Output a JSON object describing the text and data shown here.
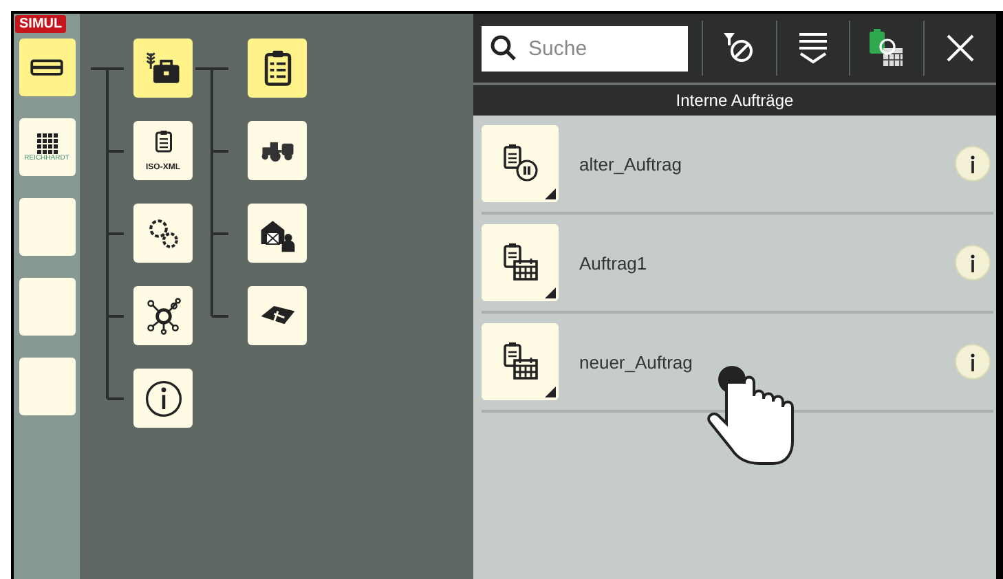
{
  "badge": "SIMUL",
  "sidebar": [
    {
      "kind": "card",
      "selected": true
    },
    {
      "kind": "logo",
      "text": "REICHHARDT",
      "selected": false
    },
    {
      "kind": "blank",
      "selected": false
    },
    {
      "kind": "blank",
      "selected": false
    },
    {
      "kind": "blank",
      "selected": false
    }
  ],
  "tree": [
    {
      "kind": "briefcase",
      "selected": true,
      "children": [
        {
          "kind": "clipboard",
          "selected": true
        },
        {
          "kind": "tractor",
          "selected": false
        },
        {
          "kind": "barn",
          "selected": false
        },
        {
          "kind": "field",
          "selected": false
        }
      ]
    },
    {
      "kind": "isoxml",
      "label": "ISO-XML",
      "selected": false
    },
    {
      "kind": "gears",
      "selected": false
    },
    {
      "kind": "network",
      "selected": false
    },
    {
      "kind": "info",
      "selected": false
    }
  ],
  "toolbar": {
    "search": {
      "placeholder": "Suche"
    }
  },
  "list_title": "Interne Aufträge",
  "orders": [
    {
      "name": "alter_Auftrag",
      "kind": "paused"
    },
    {
      "name": "Auftrag1",
      "kind": "planned"
    },
    {
      "name": "neuer_Auftrag",
      "kind": "planned"
    }
  ]
}
